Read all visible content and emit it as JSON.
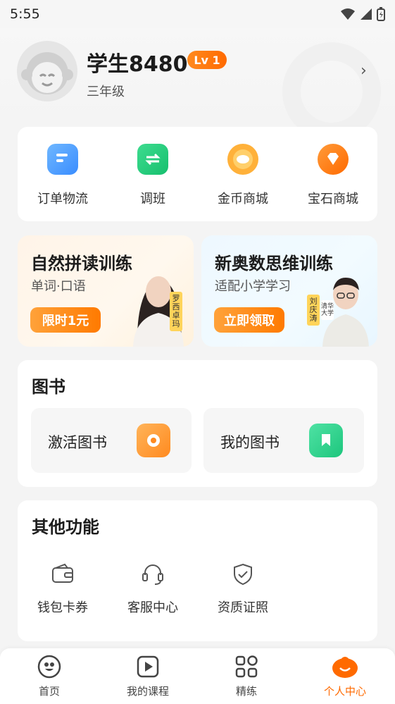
{
  "status_bar": {
    "time": "5:55"
  },
  "profile": {
    "name": "学生8480",
    "level": "Lv 1",
    "grade": "三年级"
  },
  "quick_actions": [
    {
      "label": "订单物流",
      "icon": "order-icon"
    },
    {
      "label": "调班",
      "icon": "switch-class-icon"
    },
    {
      "label": "金币商城",
      "icon": "coin-mall-icon"
    },
    {
      "label": "宝石商城",
      "icon": "gem-mall-icon"
    }
  ],
  "promos": [
    {
      "title": "自然拼读训练",
      "subtitle": "单词·口语",
      "button": "限时1元",
      "tag": "罗西卓玛"
    },
    {
      "title": "新奥数思维训练",
      "subtitle": "适配小学学习",
      "button": "立即领取",
      "tag": "刘庆涛",
      "tag2": "清华大学"
    }
  ],
  "books": {
    "title": "图书",
    "items": [
      {
        "label": "激活图书",
        "icon": "activate-book-icon"
      },
      {
        "label": "我的图书",
        "icon": "my-books-icon"
      }
    ]
  },
  "other": {
    "title": "其他功能",
    "items": [
      {
        "label": "钱包卡券",
        "icon": "wallet-icon"
      },
      {
        "label": "客服中心",
        "icon": "headset-icon"
      },
      {
        "label": "资质证照",
        "icon": "shield-check-icon"
      }
    ]
  },
  "nav": [
    {
      "label": "首页",
      "icon": "home-icon"
    },
    {
      "label": "我的课程",
      "icon": "play-icon"
    },
    {
      "label": "精练",
      "icon": "grid-icon"
    },
    {
      "label": "个人中心",
      "icon": "mascot-icon",
      "active": true
    }
  ],
  "colors": {
    "accent": "#ff6a00",
    "blue": "#4a9dff",
    "green": "#21c77a",
    "orange": "#ff8a1f"
  }
}
